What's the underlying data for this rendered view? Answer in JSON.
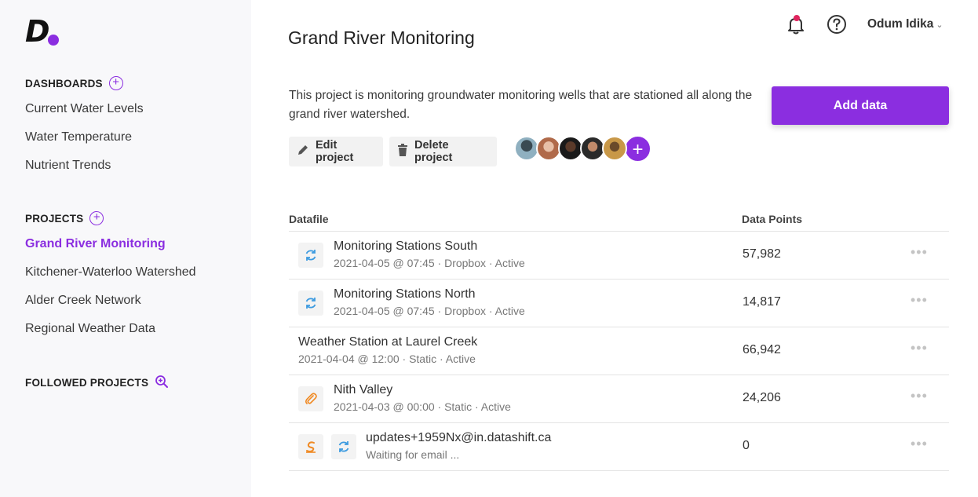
{
  "sidebar": {
    "logo": "D",
    "dashboards_title": "DASHBOARDS",
    "dashboards": [
      "Current Water Levels",
      "Water Temperature",
      "Nutrient Trends"
    ],
    "projects_title": "PROJECTS",
    "projects": [
      "Grand River Monitoring",
      "Kitchener-Waterloo Watershed",
      "Alder Creek Network",
      "Regional Weather Data"
    ],
    "active_project": "Grand River Monitoring",
    "followed_title": "FOLLOWED PROJECTS"
  },
  "header": {
    "title": "Grand River Monitoring",
    "user_name": "Odum Idika",
    "icons": [
      "bell-icon",
      "help-icon",
      "chevron-down-icon"
    ]
  },
  "project": {
    "description": "This project is monitoring groundwater monitoring wells that are stationed all along the grand river watershed.",
    "add_data_label": "Add data",
    "edit_label": "Edit project",
    "delete_label": "Delete project",
    "add_member_label": "+"
  },
  "table": {
    "headers": {
      "datafile": "Datafile",
      "points": "Data Points"
    },
    "rows": [
      {
        "name": "Monitoring Stations South",
        "meta": "2021-04-05 @ 07:45 · Dropbox · Active",
        "points": "57,982",
        "icons": [
          "sync-icon"
        ]
      },
      {
        "name": "Monitoring Stations North",
        "meta": "2021-04-05 @ 07:45 · Dropbox · Active",
        "points": "14,817",
        "icons": [
          "sync-icon"
        ]
      },
      {
        "name": "Weather Station at Laurel Creek",
        "meta": "2021-04-04 @ 12:00 · Static · Active",
        "points": "66,942",
        "icons": []
      },
      {
        "name": "Nith Valley",
        "meta": "2021-04-03 @ 00:00 · Static · Active",
        "points": "24,206",
        "icons": [
          "paperclip-icon"
        ]
      },
      {
        "name": "updates+1959Nx@in.datashift.ca",
        "meta": "Waiting for email ...",
        "points": "0",
        "icons": [
          "email-source-icon",
          "sync-icon"
        ]
      }
    ],
    "more_label": "•••"
  },
  "colors": {
    "accent": "#8b2ee0",
    "sync": "#3d9be0",
    "clip": "#f08a24",
    "notification": "#e0245e"
  }
}
